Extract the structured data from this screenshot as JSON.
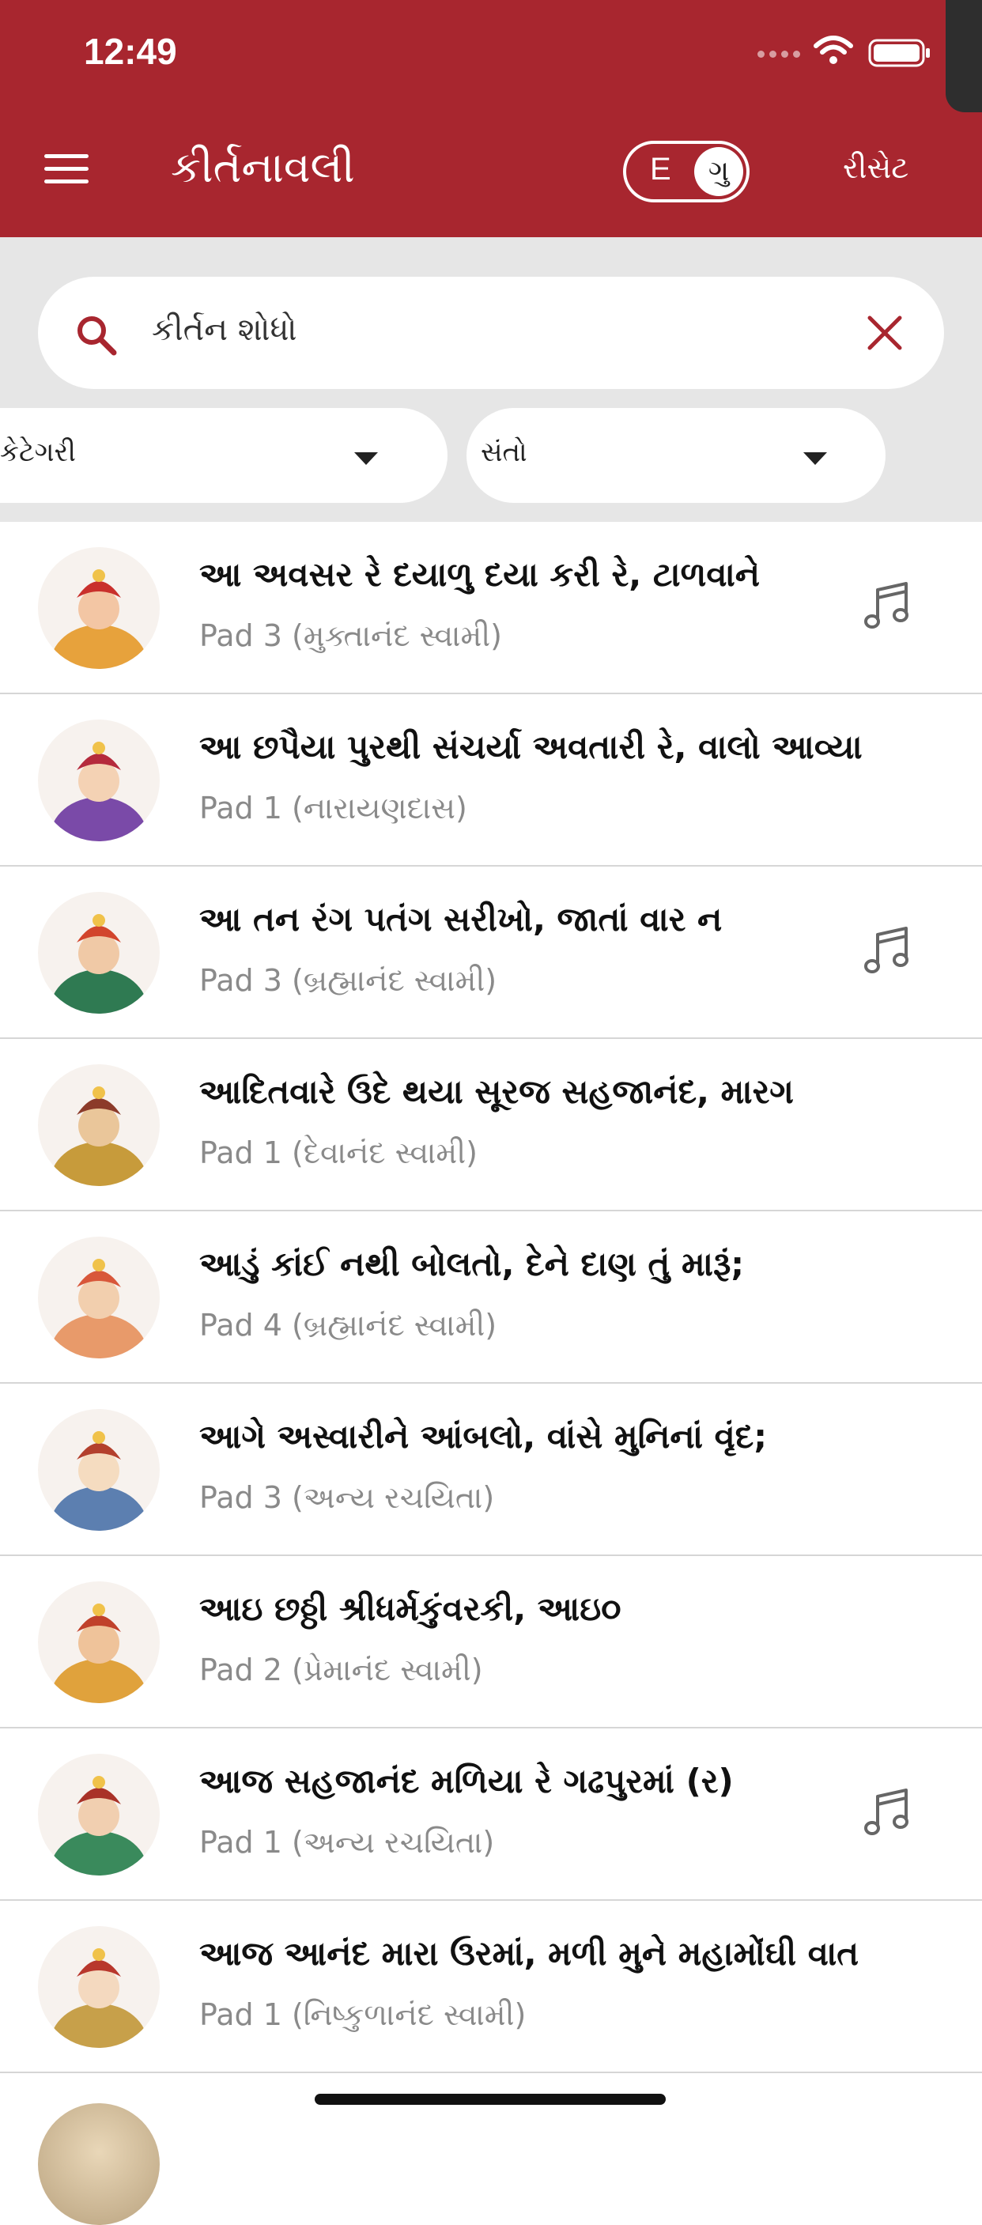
{
  "status_bar": {
    "time": "12:49"
  },
  "header": {
    "title": "કીર્તનાવલી",
    "lang_toggle": {
      "left": "E",
      "right": "ગુ",
      "selected": "ગુ"
    },
    "reset_label": "રીસેટ",
    "bg_color": "#a8262f"
  },
  "search": {
    "placeholder": "કીર્તન શોધો",
    "value": ""
  },
  "filters": {
    "category": {
      "label": "કેટેગરી"
    },
    "saints": {
      "label": "સંતો"
    }
  },
  "kirtans": [
    {
      "title": "આ અવસર રે દયાળુ દયા કરી રે, ટાળવાને",
      "subtitle": "Pad 3 (મુક્તાનંદ સ્વામી)",
      "has_audio": true
    },
    {
      "title": "આ છપૈયા પુરથી સંચર્યા અવતારી રે, વાલો આવ્યા",
      "subtitle": "Pad 1 (નારાયણદાસ)",
      "has_audio": false
    },
    {
      "title": "આ તન રંગ પતંગ સરીખો, જાતાં વાર ન",
      "subtitle": "Pad 3 (બ્રહ્માનંદ સ્વામી)",
      "has_audio": true
    },
    {
      "title": "આદિતવારે ઉદે થયા સૂરજ સહજાનંદ, મારગ",
      "subtitle": "Pad 1 (દેવાનંદ સ્વામી)",
      "has_audio": false
    },
    {
      "title": "આડું કાંઈ નથી બોલતો, દેને દાણ તું મારૂં;",
      "subtitle": "Pad 4 (બ્રહ્માનંદ સ્વામી)",
      "has_audio": false
    },
    {
      "title": "આગે અસ્વારીને આંબલો, વાંસે મુનિનાં વૃંદ;",
      "subtitle": "Pad 3 (અન્ય રચયિતા)",
      "has_audio": false
    },
    {
      "title": "આઇ છઠ્ઠી શ્રીધર્મકુંવરકી, આઇ૦",
      "subtitle": "Pad 2 (પ્રેમાનંદ સ્વામી)",
      "has_audio": false
    },
    {
      "title": "આજ સહજાનંદ મળિયા રે ગઢપુરમાં (ર)",
      "subtitle": "Pad 1 (અન્ય રચયિતા)",
      "has_audio": true
    },
    {
      "title": "આજ આનંદ મારા ઉરમાં, મળી મુને મહામોંઘી વાત",
      "subtitle": "Pad 1 (નિષ્કુળાનંદ સ્વામી)",
      "has_audio": false
    }
  ]
}
